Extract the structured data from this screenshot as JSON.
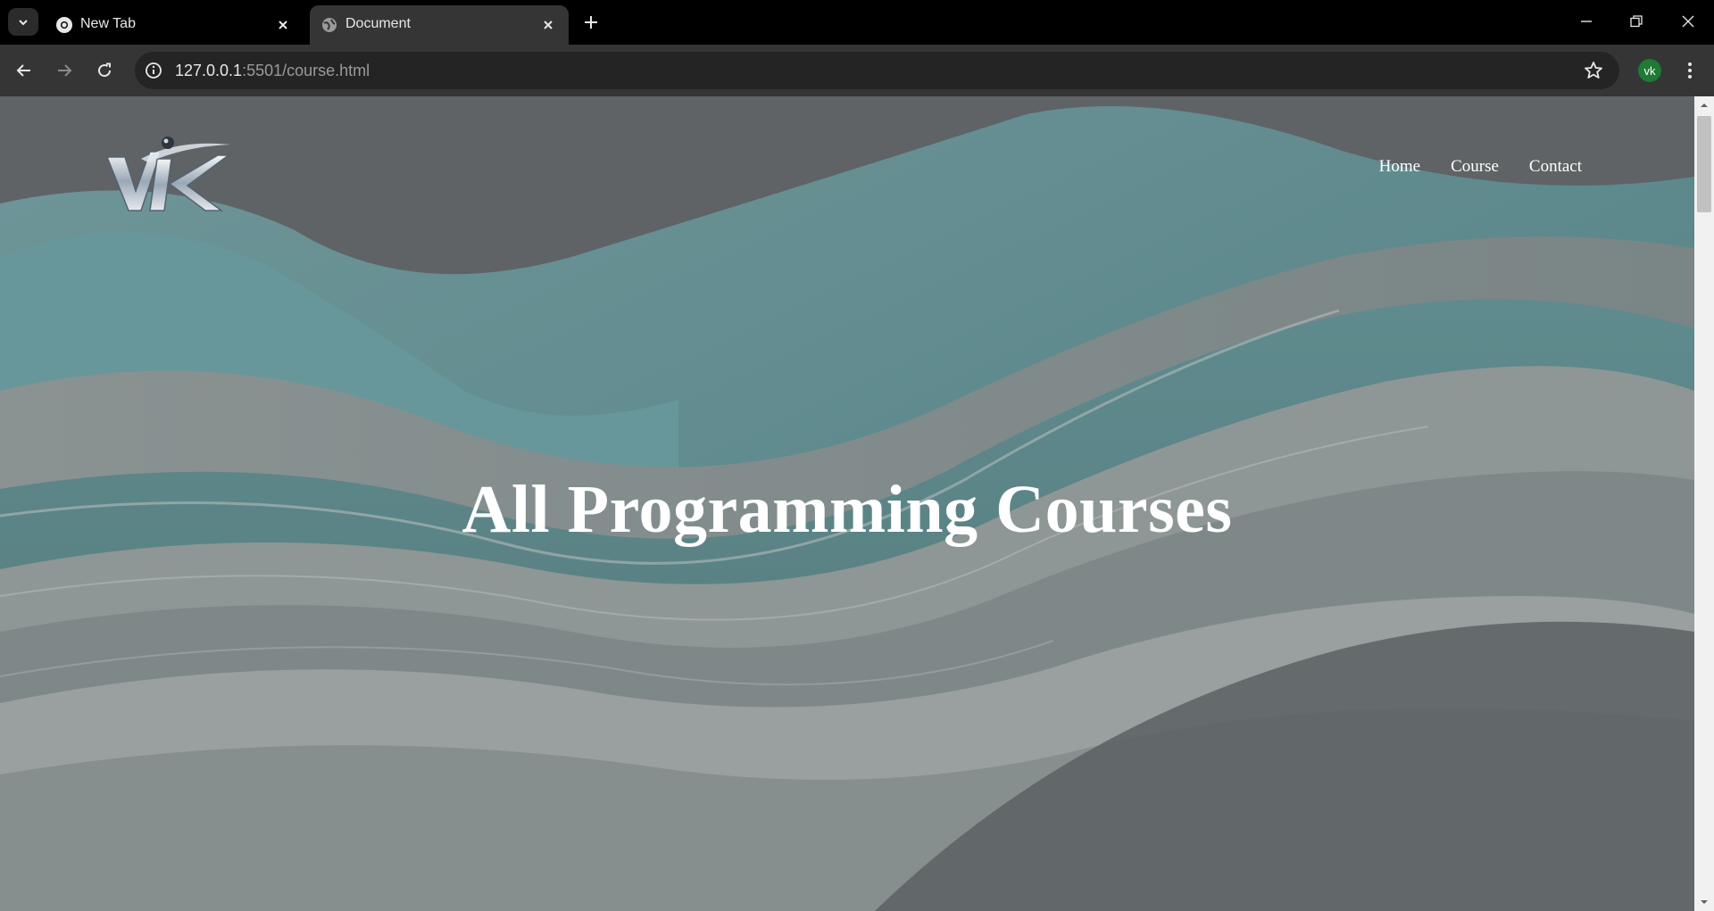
{
  "browser": {
    "tabs": [
      {
        "title": "New Tab",
        "icon": "chrome-icon",
        "active": false
      },
      {
        "title": "Document",
        "icon": "globe-icon",
        "active": true
      }
    ],
    "url_host": "127.0.0.1",
    "url_rest": ":5501/course.html",
    "profile_initials": "vk",
    "profile_color": "#1f7a35"
  },
  "page": {
    "logo_text": "VK",
    "nav": [
      {
        "label": "Home"
      },
      {
        "label": "Course"
      },
      {
        "label": "Contact"
      }
    ],
    "hero_title": "All Programming Courses"
  },
  "colors": {
    "toolbar": "#353535",
    "tabstrip": "#000000",
    "hero_text": "#ffffff",
    "background_teal": "#5f8b8e"
  }
}
